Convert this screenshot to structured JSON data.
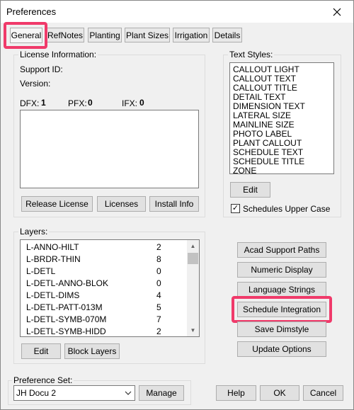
{
  "window": {
    "title": "Preferences"
  },
  "tabs": [
    {
      "label": "General"
    },
    {
      "label": "RefNotes"
    },
    {
      "label": "Planting"
    },
    {
      "label": "Plant Sizes"
    },
    {
      "label": "Irrigation"
    },
    {
      "label": "Details"
    }
  ],
  "license": {
    "group_label": "License Information:",
    "support_id_label": "Support ID:",
    "version_label": "Version:",
    "dfx_label": "DFX:",
    "dfx_value": "1",
    "pfx_label": "PFX:",
    "pfx_value": "0",
    "ifx_label": "IFX:",
    "ifx_value": "0",
    "release_button": "Release License",
    "licenses_button": "Licenses",
    "install_info_button": "Install Info"
  },
  "text_styles": {
    "group_label": "Text Styles:",
    "items": [
      "CALLOUT LIGHT",
      "CALLOUT TEXT",
      "CALLOUT TITLE",
      "DETAIL TEXT",
      "DIMENSION TEXT",
      "LATERAL SIZE",
      "MAINLINE SIZE",
      "PHOTO LABEL",
      "PLANT CALLOUT",
      "SCHEDULE TEXT",
      "SCHEDULE TITLE",
      "ZONE"
    ],
    "edit_button": "Edit",
    "upper_case_label": "Schedules Upper Case",
    "upper_case_checked": true
  },
  "layers": {
    "group_label": "Layers:",
    "items": [
      {
        "name": "L-ANNO-HILT",
        "count": "2"
      },
      {
        "name": "L-BRDR-THIN",
        "count": "8"
      },
      {
        "name": "L-DETL",
        "count": "0"
      },
      {
        "name": "L-DETL-ANNO-BLOK",
        "count": "0"
      },
      {
        "name": "L-DETL-DIMS",
        "count": "4"
      },
      {
        "name": "L-DETL-PATT-013M",
        "count": "5"
      },
      {
        "name": "L-DETL-SYMB-070M",
        "count": "7"
      },
      {
        "name": "L-DETL-SYMB-HIDD",
        "count": "2"
      }
    ],
    "edit_button": "Edit",
    "block_layers_button": "Block Layers"
  },
  "side_buttons": {
    "acad_support_paths": "Acad Support Paths",
    "numeric_display": "Numeric Display",
    "language_strings": "Language Strings",
    "schedule_integration": "Schedule Integration",
    "save_dimstyle": "Save Dimstyle",
    "update_options": "Update Options"
  },
  "preference_set": {
    "group_label": "Preference Set:",
    "value": "JH Docu 2",
    "manage_button": "Manage"
  },
  "footer": {
    "help_button": "Help",
    "ok_button": "OK",
    "cancel_button": "Cancel"
  },
  "colors": {
    "highlight": "#f03a6a",
    "dialog_bg": "#f0f0f0",
    "button_bg": "#e1e1e1"
  }
}
